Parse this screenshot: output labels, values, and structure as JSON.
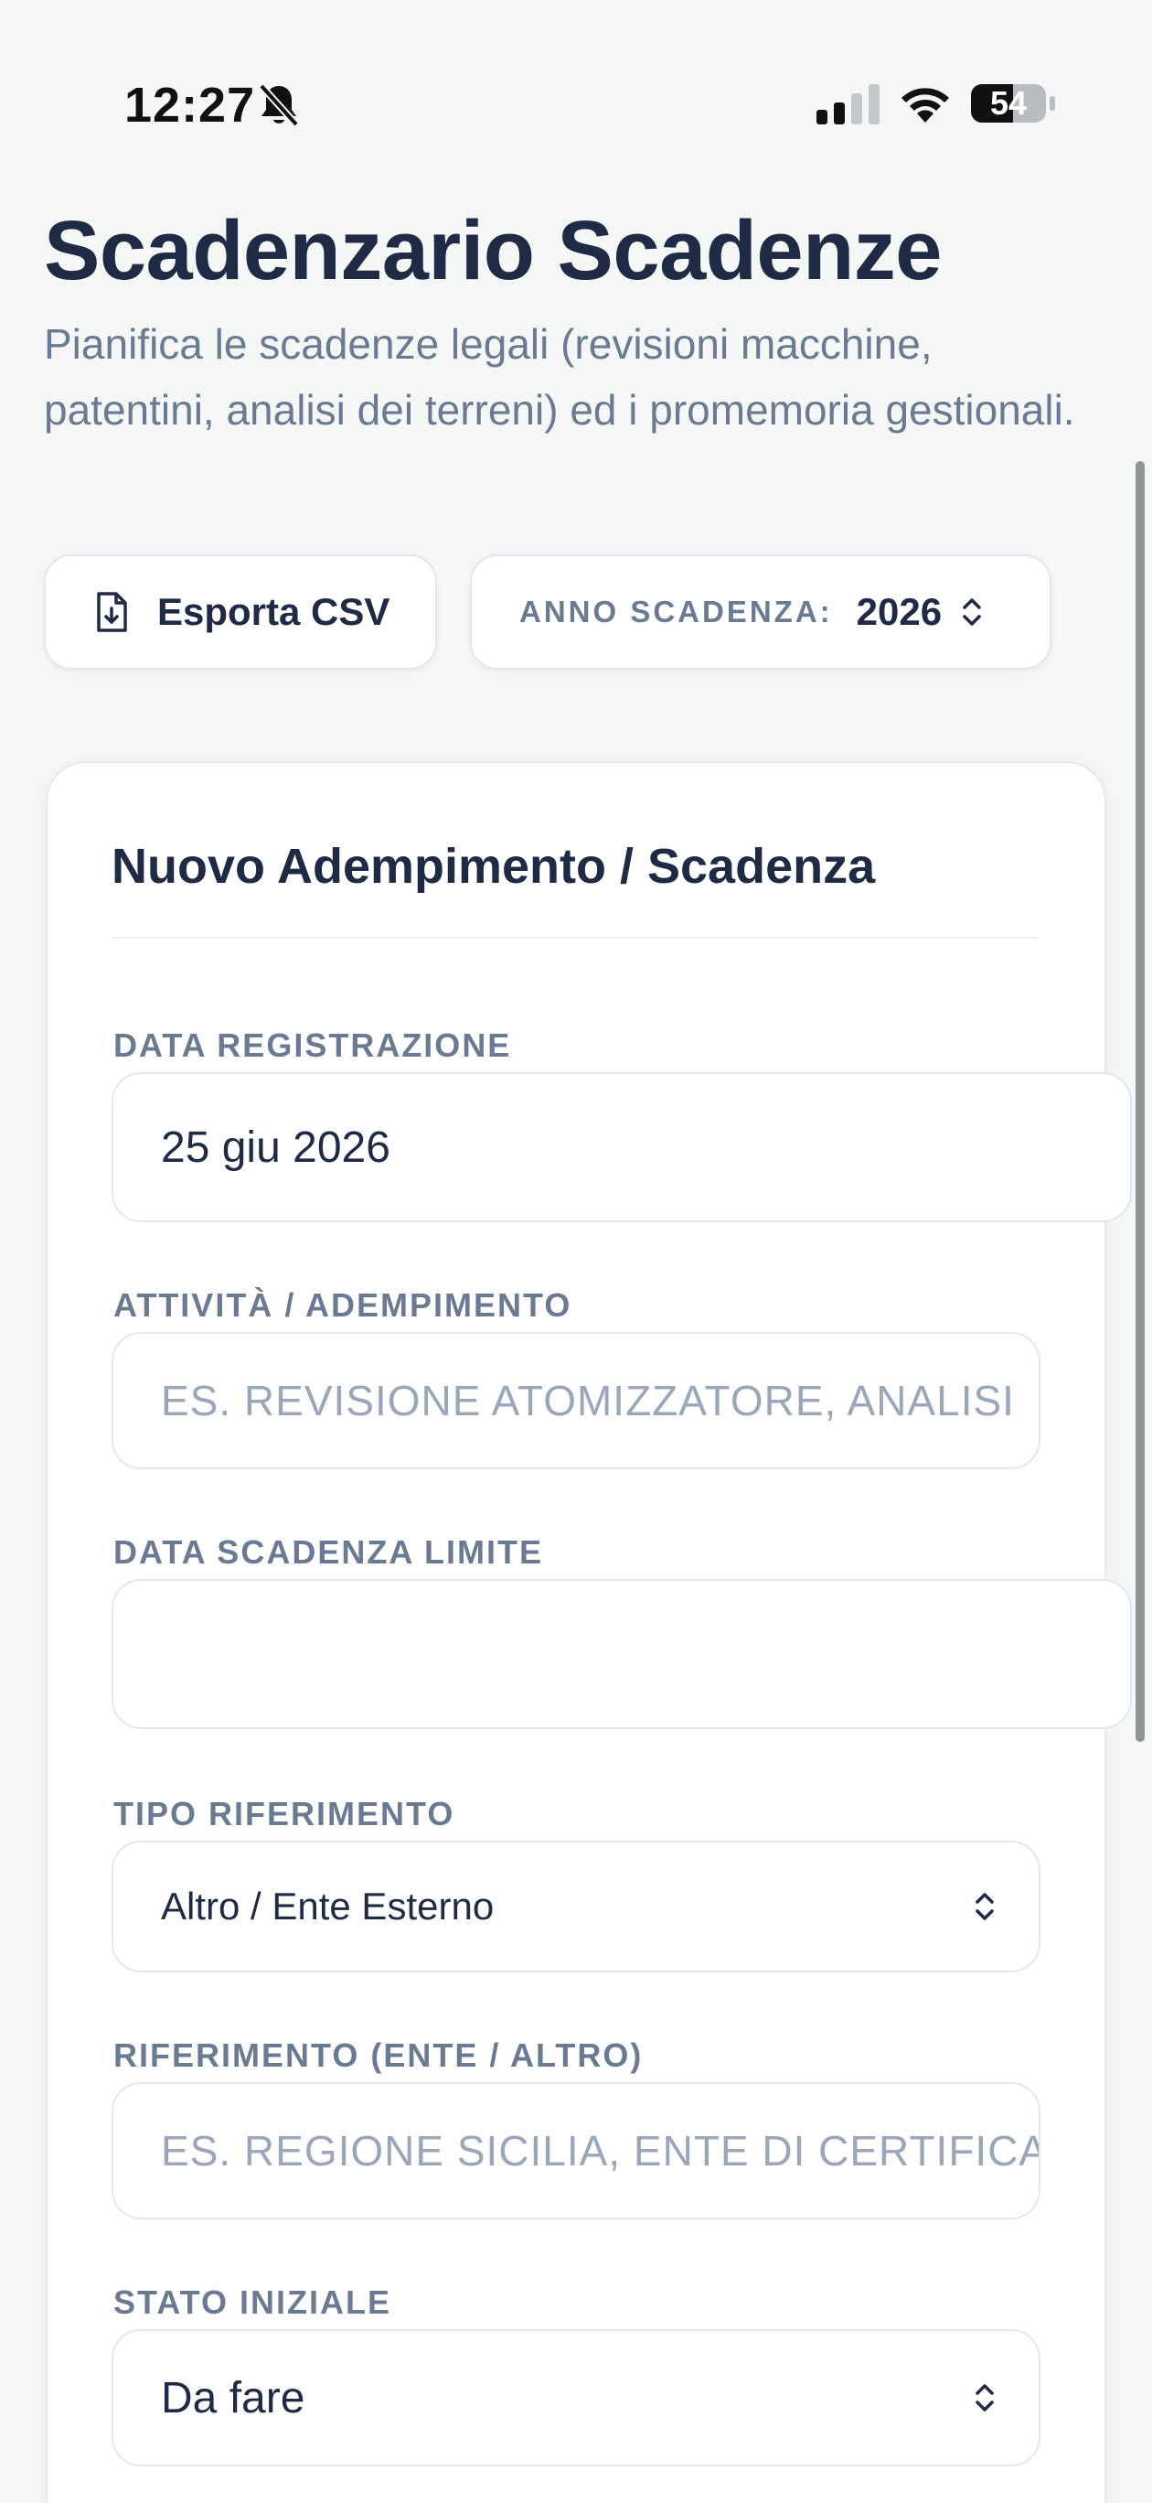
{
  "status_bar": {
    "time": "12:27",
    "battery": "54",
    "icons": [
      "bell-slash-icon",
      "cellular-signal-icon",
      "wifi-icon",
      "battery-icon"
    ]
  },
  "header": {
    "title": "Scadenzario Scadenze",
    "subtitle": "Pianifica le scadenze legali (revisioni macchine, patentini, analisi dei terreni) ed i promemoria gestionali."
  },
  "toolbar": {
    "export_label": "Esporta CSV",
    "export_icon": "file-download-icon",
    "year_label": "ANNO SCADENZA:",
    "year_value": "2026"
  },
  "form": {
    "title": "Nuovo Adempimento / Scadenza",
    "registration_date": {
      "label": "DATA REGISTRAZIONE",
      "value": "25 giu 2026"
    },
    "activity": {
      "label": "ATTIVITÀ / ADEMPIMENTO",
      "placeholder": "ES. REVISIONE ATOMIZZATORE, ANALISI"
    },
    "due_date": {
      "label": "DATA SCADENZA LIMITE",
      "value": ""
    },
    "reference_type": {
      "label": "TIPO RIFERIMENTO",
      "value": "Altro / Ente Esterno"
    },
    "reference": {
      "label": "RIFERIMENTO (ENTE / ALTRO)",
      "placeholder": "ES. REGIONE SICILIA, ENTE DI CERTIFICAZIONE"
    },
    "initial_status": {
      "label": "STATO INIZIALE",
      "value": "Da fare"
    }
  },
  "colors": {
    "background": "#f5f7f6",
    "text_primary": "#1f2a44",
    "text_muted": "#6b7a93",
    "placeholder": "#9aa6ba",
    "border": "#e3e7ee"
  }
}
